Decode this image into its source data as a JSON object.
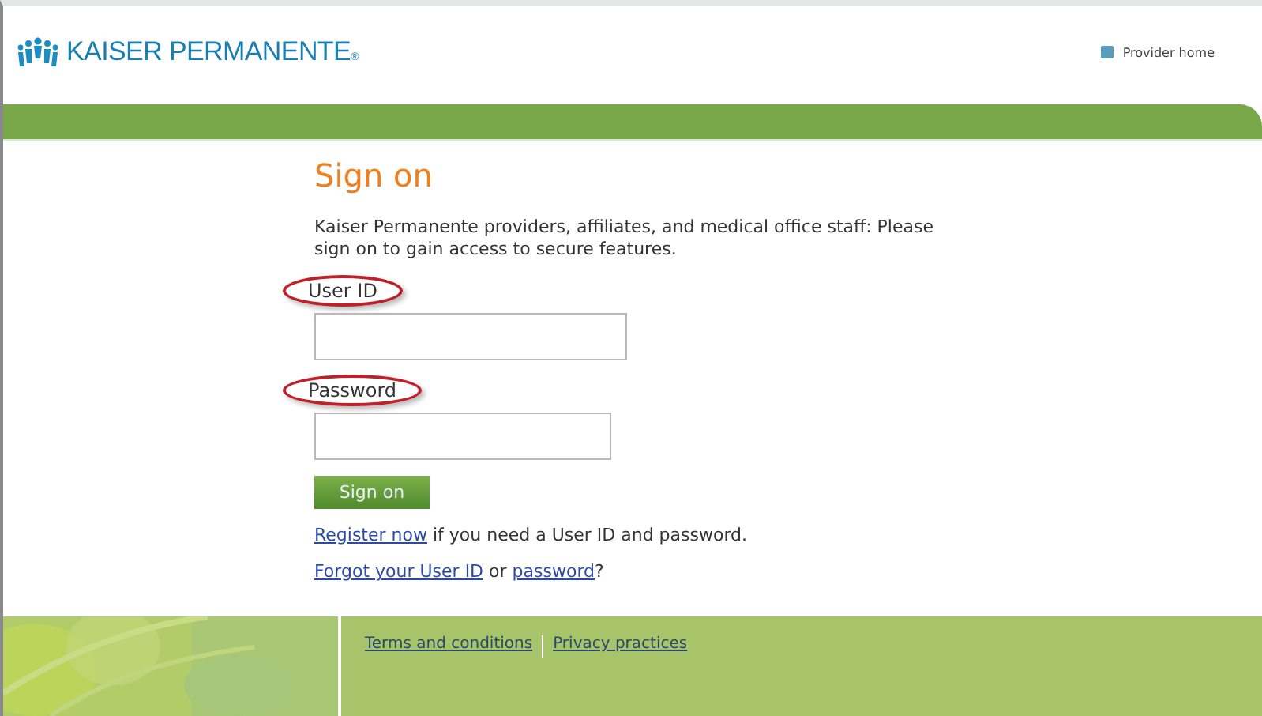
{
  "header": {
    "logo": {
      "text": "KAISER PERMANENTE",
      "mark": "®"
    },
    "link": "Provider home"
  },
  "form": {
    "title": "Sign on",
    "intro": "Kaiser Permanente providers, affiliates, and medical office staff: Please sign on to gain access to secure features.",
    "fields": [
      {
        "label": "User ID",
        "highlighted": true
      },
      {
        "label": "Password",
        "highlighted": true
      }
    ],
    "button": "Sign on",
    "lines": [
      [
        {
          "kind": "link",
          "text": "Register now"
        },
        {
          "kind": "text",
          "text": " if you need a User ID and password."
        }
      ],
      [
        {
          "kind": "link",
          "text": "Forgot your User ID"
        },
        {
          "kind": "text",
          "text": " or "
        },
        {
          "kind": "link",
          "text": "password"
        },
        {
          "kind": "text",
          "text": "?"
        }
      ]
    ]
  },
  "footer": {
    "links": [
      "Terms and conditions",
      "Privacy practices"
    ]
  }
}
